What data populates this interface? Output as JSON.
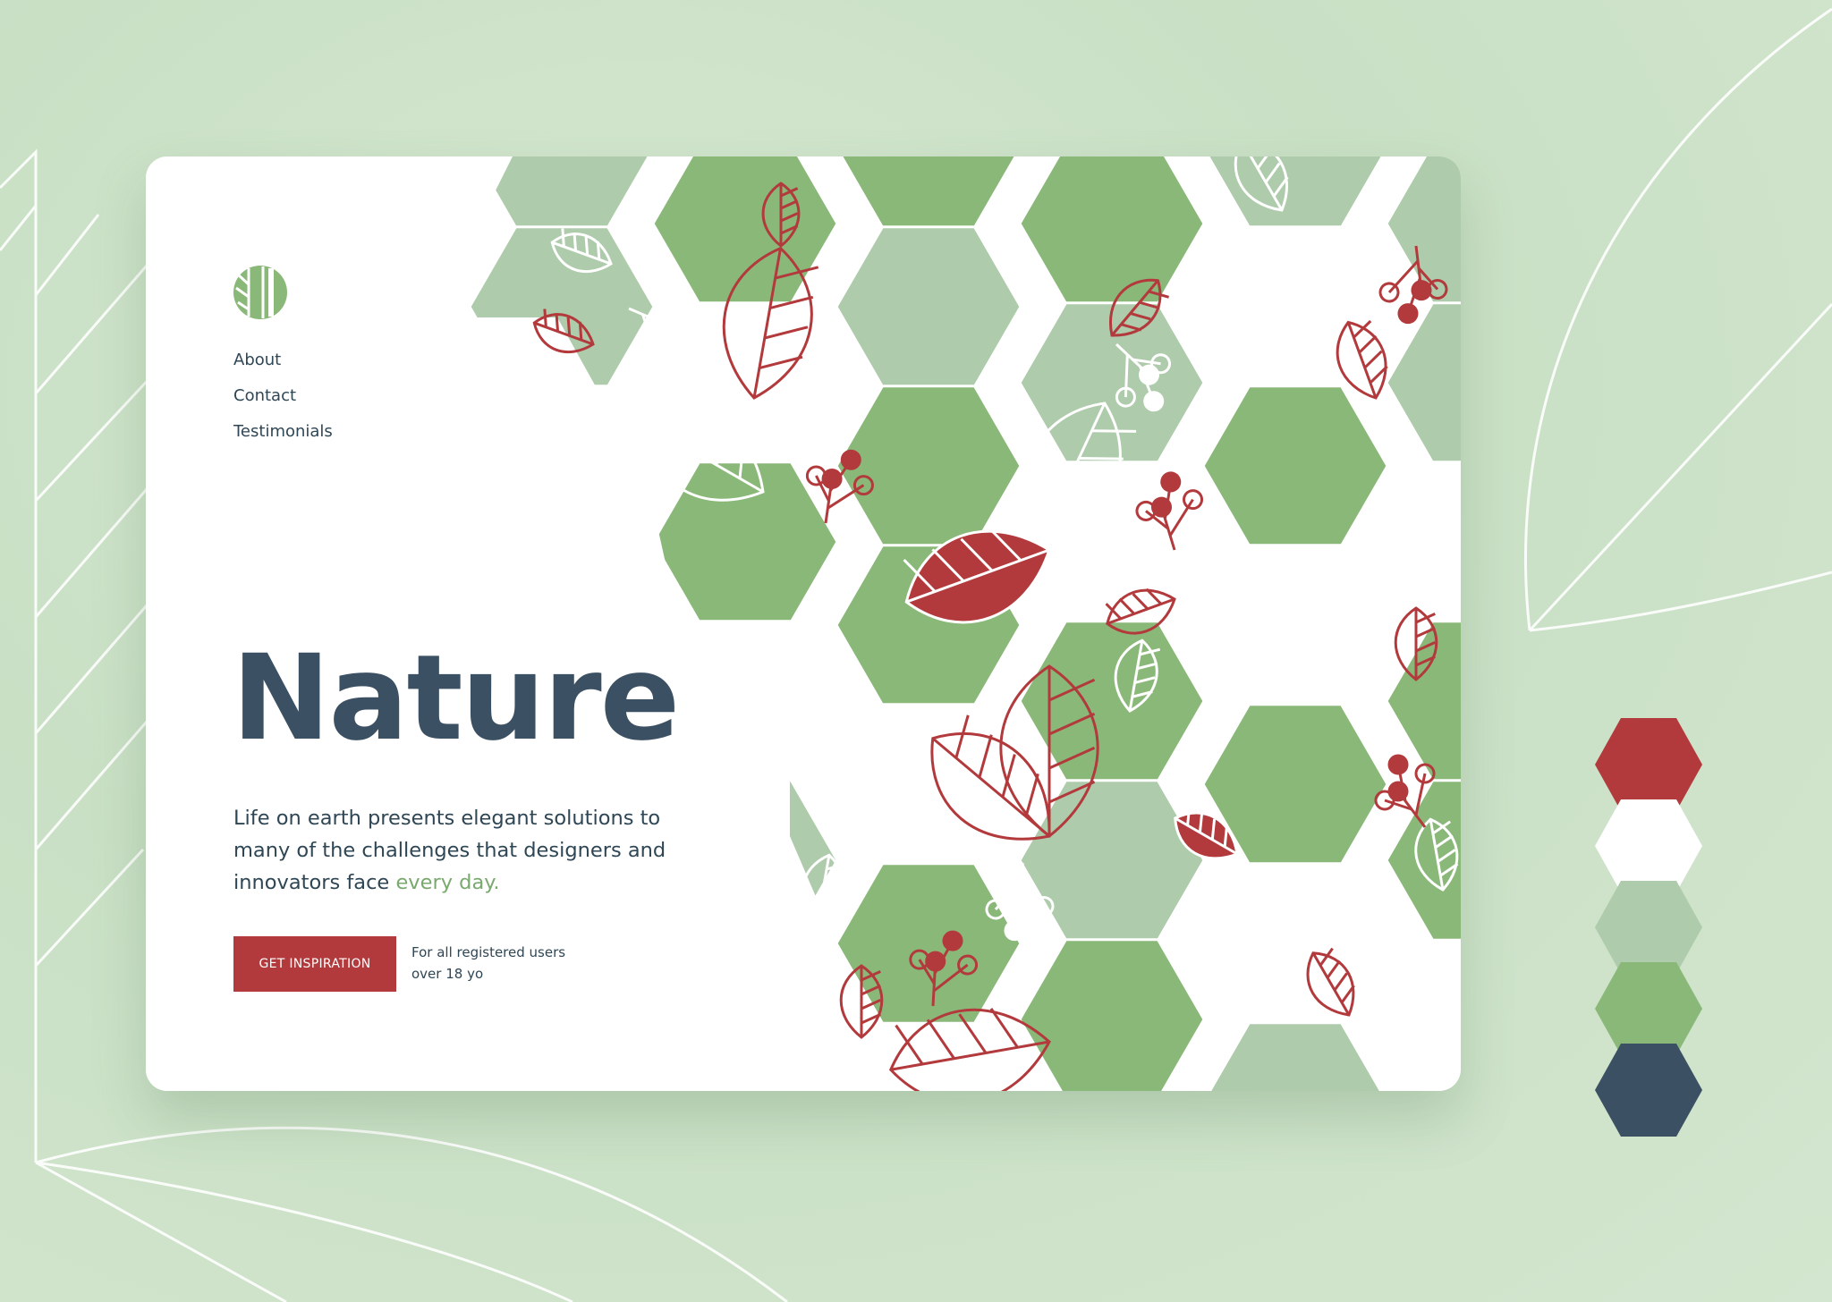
{
  "nav": {
    "items": [
      "About",
      "Contact",
      "Testimonials"
    ]
  },
  "hero": {
    "title": "Nature",
    "description": "Life on earth presents elegant solutions to many of the challenges that designers and innovators face ",
    "description_highlight": "every day.",
    "cta_label": "GET INSPIRATION",
    "note": "For all registered users over 18 yo"
  },
  "icons": {
    "logo": "leaf-logo-icon",
    "motifs": [
      "leaf-icon",
      "berry-sprig-icon"
    ]
  },
  "palette": {
    "red": "#b23a3c",
    "white": "#ffffff",
    "light_green": "#aecbab",
    "green": "#8ab878",
    "navy": "#3b5062",
    "highlight": "#7aa96e"
  },
  "swatches": [
    {
      "name": "red",
      "color": "#b23a3c"
    },
    {
      "name": "white",
      "color": "#ffffff"
    },
    {
      "name": "light-green",
      "color": "#aecbab"
    },
    {
      "name": "green",
      "color": "#8ab878"
    },
    {
      "name": "navy",
      "color": "#3b5062"
    }
  ]
}
